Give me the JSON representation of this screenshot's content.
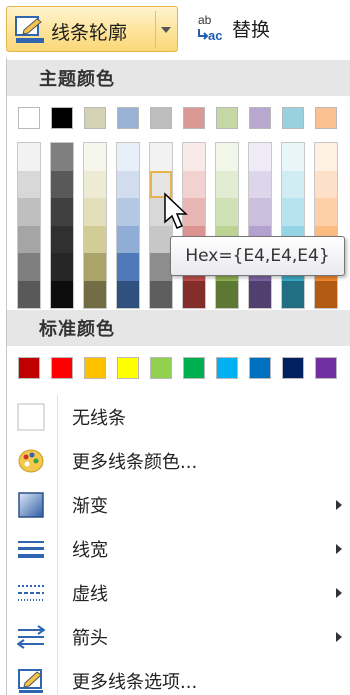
{
  "ribbon": {
    "outline_button_label": "线条轮廓",
    "replace_button_label": "替换"
  },
  "theme_colors": {
    "header": "主题颜色",
    "base": [
      "#ffffff",
      "#000000",
      "#d4d2b4",
      "#9bb2d7",
      "#bdbdbd",
      "#da9995",
      "#c5d7a5",
      "#b8a7cf",
      "#98d2e0",
      "#fbc08f"
    ],
    "shades": [
      [
        "#f2f2f2",
        "#d8d8d8",
        "#bfbfbf",
        "#a5a5a5",
        "#7f7f7f",
        "#595959"
      ],
      [
        "#7f7f7f",
        "#595959",
        "#404040",
        "#303030",
        "#262626",
        "#0d0d0d"
      ],
      [
        "#f7f6ec",
        "#eeebd4",
        "#e3dfba",
        "#d2cd97",
        "#aaa36a",
        "#736d45"
      ],
      [
        "#e8eef7",
        "#d1ddee",
        "#b4c7e3",
        "#8fadd5",
        "#4f79b7",
        "#30507d"
      ],
      [
        "#f2f2f2",
        "#e4e4e4",
        "#d8d8d8",
        "#c7c7c7",
        "#8d8d8d",
        "#5e5e5e"
      ],
      [
        "#f9e9e8",
        "#f1d2d1",
        "#e8b6b4",
        "#dd9390",
        "#bf4e4a",
        "#832e2b"
      ],
      [
        "#f1f6e8",
        "#e2ecd1",
        "#d1e1b6",
        "#bcd394",
        "#8cb153",
        "#5c7833"
      ],
      [
        "#efebf6",
        "#ddd6ea",
        "#cbbfde",
        "#b3a1cf",
        "#7b64a5",
        "#51406f"
      ],
      [
        "#e8f6f9",
        "#d0edf3",
        "#b7e3ee",
        "#93d4e5",
        "#3ea8c4",
        "#226e82"
      ],
      [
        "#fff0e4",
        "#fee0c8",
        "#fdd0aa",
        "#fbbc82",
        "#ef8a2f",
        "#b25a12"
      ]
    ],
    "tooltip": "Hex={E4,E4,E4}"
  },
  "standard_colors": {
    "header": "标准颜色",
    "colors": [
      "#c00000",
      "#ff0000",
      "#ffc000",
      "#ffff00",
      "#92d050",
      "#00b050",
      "#00b0f0",
      "#0070c0",
      "#002060",
      "#7030a0"
    ]
  },
  "menu": {
    "no_line": "无线条",
    "more_colors": "更多线条颜色...",
    "gradient": "渐变",
    "weight": "线宽",
    "dashes": "虚线",
    "arrows": "箭头",
    "more_options": "更多线条选项..."
  }
}
